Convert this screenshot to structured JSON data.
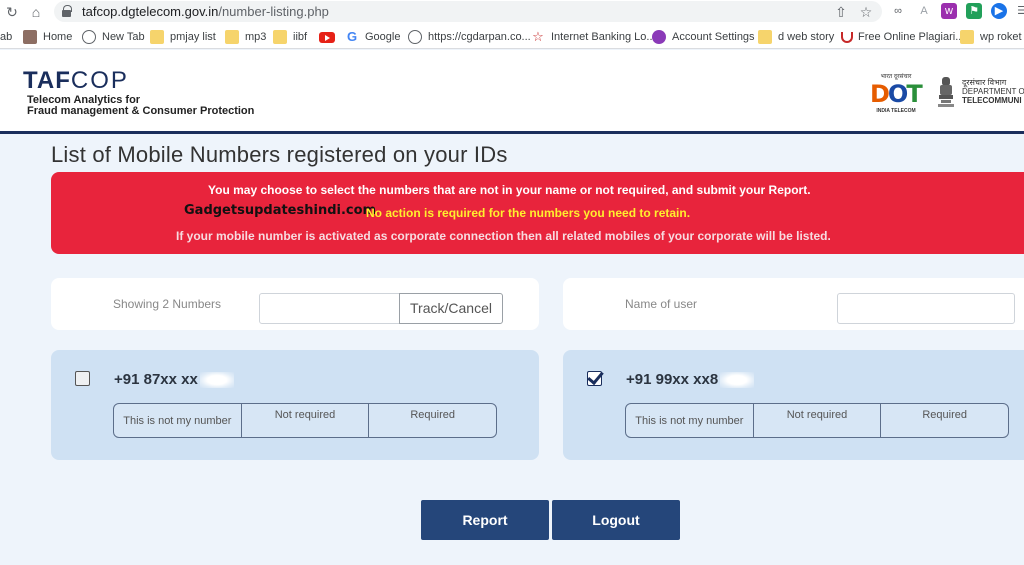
{
  "browser": {
    "url_domain": "tafcop.dgtelecom.gov.in",
    "url_path": "/number-listing.php",
    "bookmarks": [
      {
        "label": "ab",
        "icon": "none"
      },
      {
        "label": "Home",
        "icon": "home-icon"
      },
      {
        "label": "New Tab",
        "icon": "globe-icon"
      },
      {
        "label": "pmjay list",
        "icon": "folder-icon"
      },
      {
        "label": "mp3",
        "icon": "folder-icon"
      },
      {
        "label": "iibf",
        "icon": "folder-icon"
      },
      {
        "label": "",
        "icon": "youtube-icon"
      },
      {
        "label": "Google",
        "icon": "google-icon"
      },
      {
        "label": "https://cgdarpan.co...",
        "icon": "globe-icon"
      },
      {
        "label": "Internet Banking Lo...",
        "icon": "bank-icon"
      },
      {
        "label": "Account Settings",
        "icon": "purple-circle-icon"
      },
      {
        "label": "d web story",
        "icon": "folder-icon"
      },
      {
        "label": "Free Online Plagiari...",
        "icon": "hook-icon"
      },
      {
        "label": "wp roket s",
        "icon": "folder-icon"
      }
    ]
  },
  "header": {
    "logo_taf": "TAF",
    "logo_cop": "COP",
    "subtitle_line1": "Telecom Analytics for",
    "subtitle_line2": "Fraud management & Consumer Protection",
    "dot_hindi": "भारत दूरसंचार",
    "dot_d": "D",
    "dot_o": "O",
    "dot_t": "T",
    "dot_sub": "INDIA TELECOM",
    "dept_hindi": "दूरसंचार विभाग",
    "dept_line1": "DEPARTMENT OF",
    "dept_line2": "TELECOMMUNI"
  },
  "main": {
    "title": "List of Mobile Numbers registered on your IDs",
    "alert": {
      "line1": "You may choose to select the numbers that are not in your name or not required, and submit your Report.",
      "line2": "No action is required for the numbers you need to retain.",
      "line3": "If your mobile number is activated as corporate connection then all related mobiles of your corporate will be listed.",
      "watermark": "Gadgetsupdateshindi.com"
    },
    "filter_left": {
      "label": "Showing 2 Numbers",
      "input_value": "",
      "button": "Track/Cancel"
    },
    "filter_right": {
      "label": "Name of user",
      "input_value": ""
    },
    "numbers": [
      {
        "number": "+91 87xx xx",
        "checked": false,
        "options": [
          "This is not my number",
          "Not required",
          "Required"
        ]
      },
      {
        "number": "+91 99xx xx8",
        "checked": true,
        "options": [
          "This is not my number",
          "Not required",
          "Required"
        ]
      }
    ],
    "buttons": {
      "report": "Report",
      "logout": "Logout"
    }
  },
  "colors": {
    "navy": "#1a2e5c",
    "alert_red": "#e8243c",
    "alert_yellow": "#ffef2e",
    "card_blue": "#cfe1f3",
    "button_blue": "#25467a"
  }
}
